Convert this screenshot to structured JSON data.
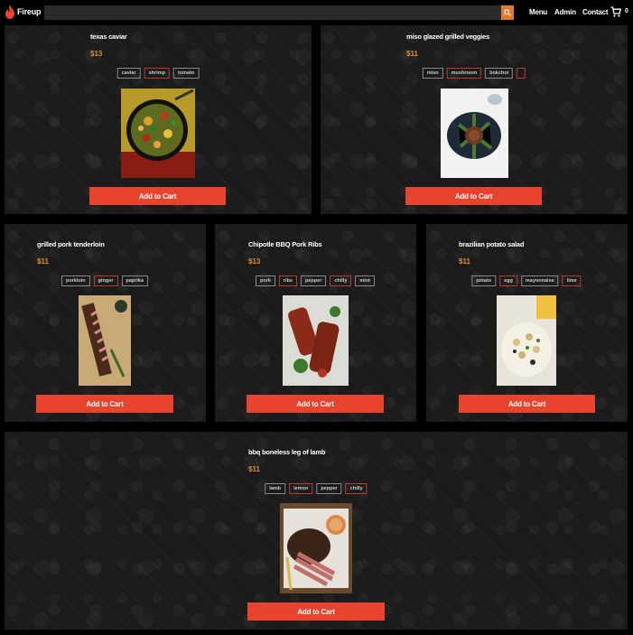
{
  "header": {
    "logo_text": "Fireup",
    "search_placeholder": "",
    "nav": {
      "menu": "Menu",
      "admin": "Admin",
      "contact": "Contact"
    },
    "cart_count": "0"
  },
  "products": [
    {
      "title": "texas caviar",
      "price": "$13",
      "tags": [
        {
          "label": "caviar",
          "red": false
        },
        {
          "label": "shrimp",
          "red": true
        },
        {
          "label": "tomato",
          "red": false
        }
      ],
      "button": "Add to Cart"
    },
    {
      "title": "miso glazed grilled veggies",
      "price": "$11",
      "tags": [
        {
          "label": "miso",
          "red": false
        },
        {
          "label": "mushroom",
          "red": true
        },
        {
          "label": "bokchoi",
          "red": false
        },
        {
          "label": "",
          "red": true
        }
      ],
      "button": "Add to Cart"
    },
    {
      "title": "grilled pork tenderloin",
      "price": "$11",
      "tags": [
        {
          "label": "porkloin",
          "red": false
        },
        {
          "label": "ginger",
          "red": true
        },
        {
          "label": "paprika",
          "red": false
        }
      ],
      "button": "Add to Cart"
    },
    {
      "title": "Chipotle BBQ Pork Ribs",
      "price": "$13",
      "tags": [
        {
          "label": "pork",
          "red": false
        },
        {
          "label": "ribs",
          "red": true
        },
        {
          "label": "pepper",
          "red": false
        },
        {
          "label": "chilly",
          "red": true
        },
        {
          "label": "mint",
          "red": false
        }
      ],
      "button": "Add to Cart"
    },
    {
      "title": "brazilian potato salad",
      "price": "$11",
      "tags": [
        {
          "label": "potato",
          "red": false
        },
        {
          "label": "egg",
          "red": true
        },
        {
          "label": "mayonnaise",
          "red": false
        },
        {
          "label": "lime",
          "red": true
        }
      ],
      "button": "Add to Cart"
    },
    {
      "title": "bbq boneless leg of lamb",
      "price": "$11",
      "tags": [
        {
          "label": "lamb",
          "red": false
        },
        {
          "label": "lemon",
          "red": true
        },
        {
          "label": "pepper",
          "red": false
        },
        {
          "label": "chilly",
          "red": true
        }
      ],
      "button": "Add to Cart"
    }
  ],
  "colors": {
    "accent": "#e8432c",
    "price": "#e08a2a",
    "search_button": "#e07a2c",
    "card_bg": "#1b1b1b"
  }
}
